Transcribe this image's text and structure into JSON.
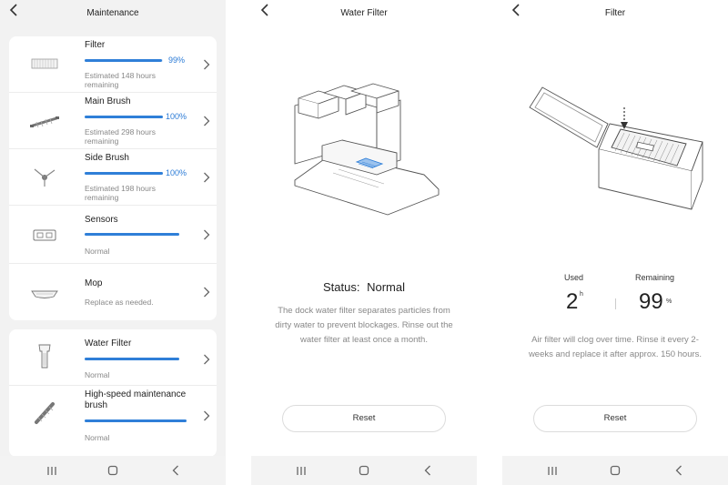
{
  "maintenance": {
    "title": "Maintenance",
    "items": [
      {
        "name": "Filter",
        "percent_label": "99%",
        "percent": 99,
        "subtitle": "Estimated 148 hours remaining"
      },
      {
        "name": "Main Brush",
        "percent_label": "100%",
        "percent": 100,
        "subtitle": "Estimated 298 hours remaining"
      },
      {
        "name": "Side Brush",
        "percent_label": "100%",
        "percent": 100,
        "subtitle": "Estimated 198 hours remaining"
      },
      {
        "name": "Sensors",
        "percent": 100,
        "subtitle": "Normal"
      },
      {
        "name": "Mop",
        "subtitle": "Replace as needed."
      }
    ],
    "dock_items": [
      {
        "name": "Water Filter",
        "percent": 100,
        "subtitle": "Normal"
      },
      {
        "name": "High-speed maintenance brush",
        "percent": 100,
        "subtitle": "Normal"
      }
    ]
  },
  "water_filter": {
    "title": "Water Filter",
    "status_label": "Status:",
    "status_value": "Normal",
    "description": "The dock water filter separates particles from dirty water to prevent blockages. Rinse out the water filter at least once a month.",
    "reset_label": "Reset"
  },
  "filter": {
    "title": "Filter",
    "used_label": "Used",
    "used_value": "2",
    "used_unit": "h",
    "remaining_label": "Remaining",
    "remaining_value": "99",
    "remaining_unit": "%",
    "description": "Air filter will clog over time. Rinse it every 2-weeks and replace it after approx. 150 hours.",
    "reset_label": "Reset"
  },
  "icons": {
    "back": "chevron-left-icon",
    "chevron": "chevron-right-icon",
    "recent": "recent-apps-icon",
    "home": "home-icon",
    "nav_back": "nav-back-icon"
  },
  "colors": {
    "accent": "#2f7fd8",
    "bar_track": "#d8e7f8",
    "list_background": "#f2f2f2",
    "navbar": "#f3f3f3"
  }
}
